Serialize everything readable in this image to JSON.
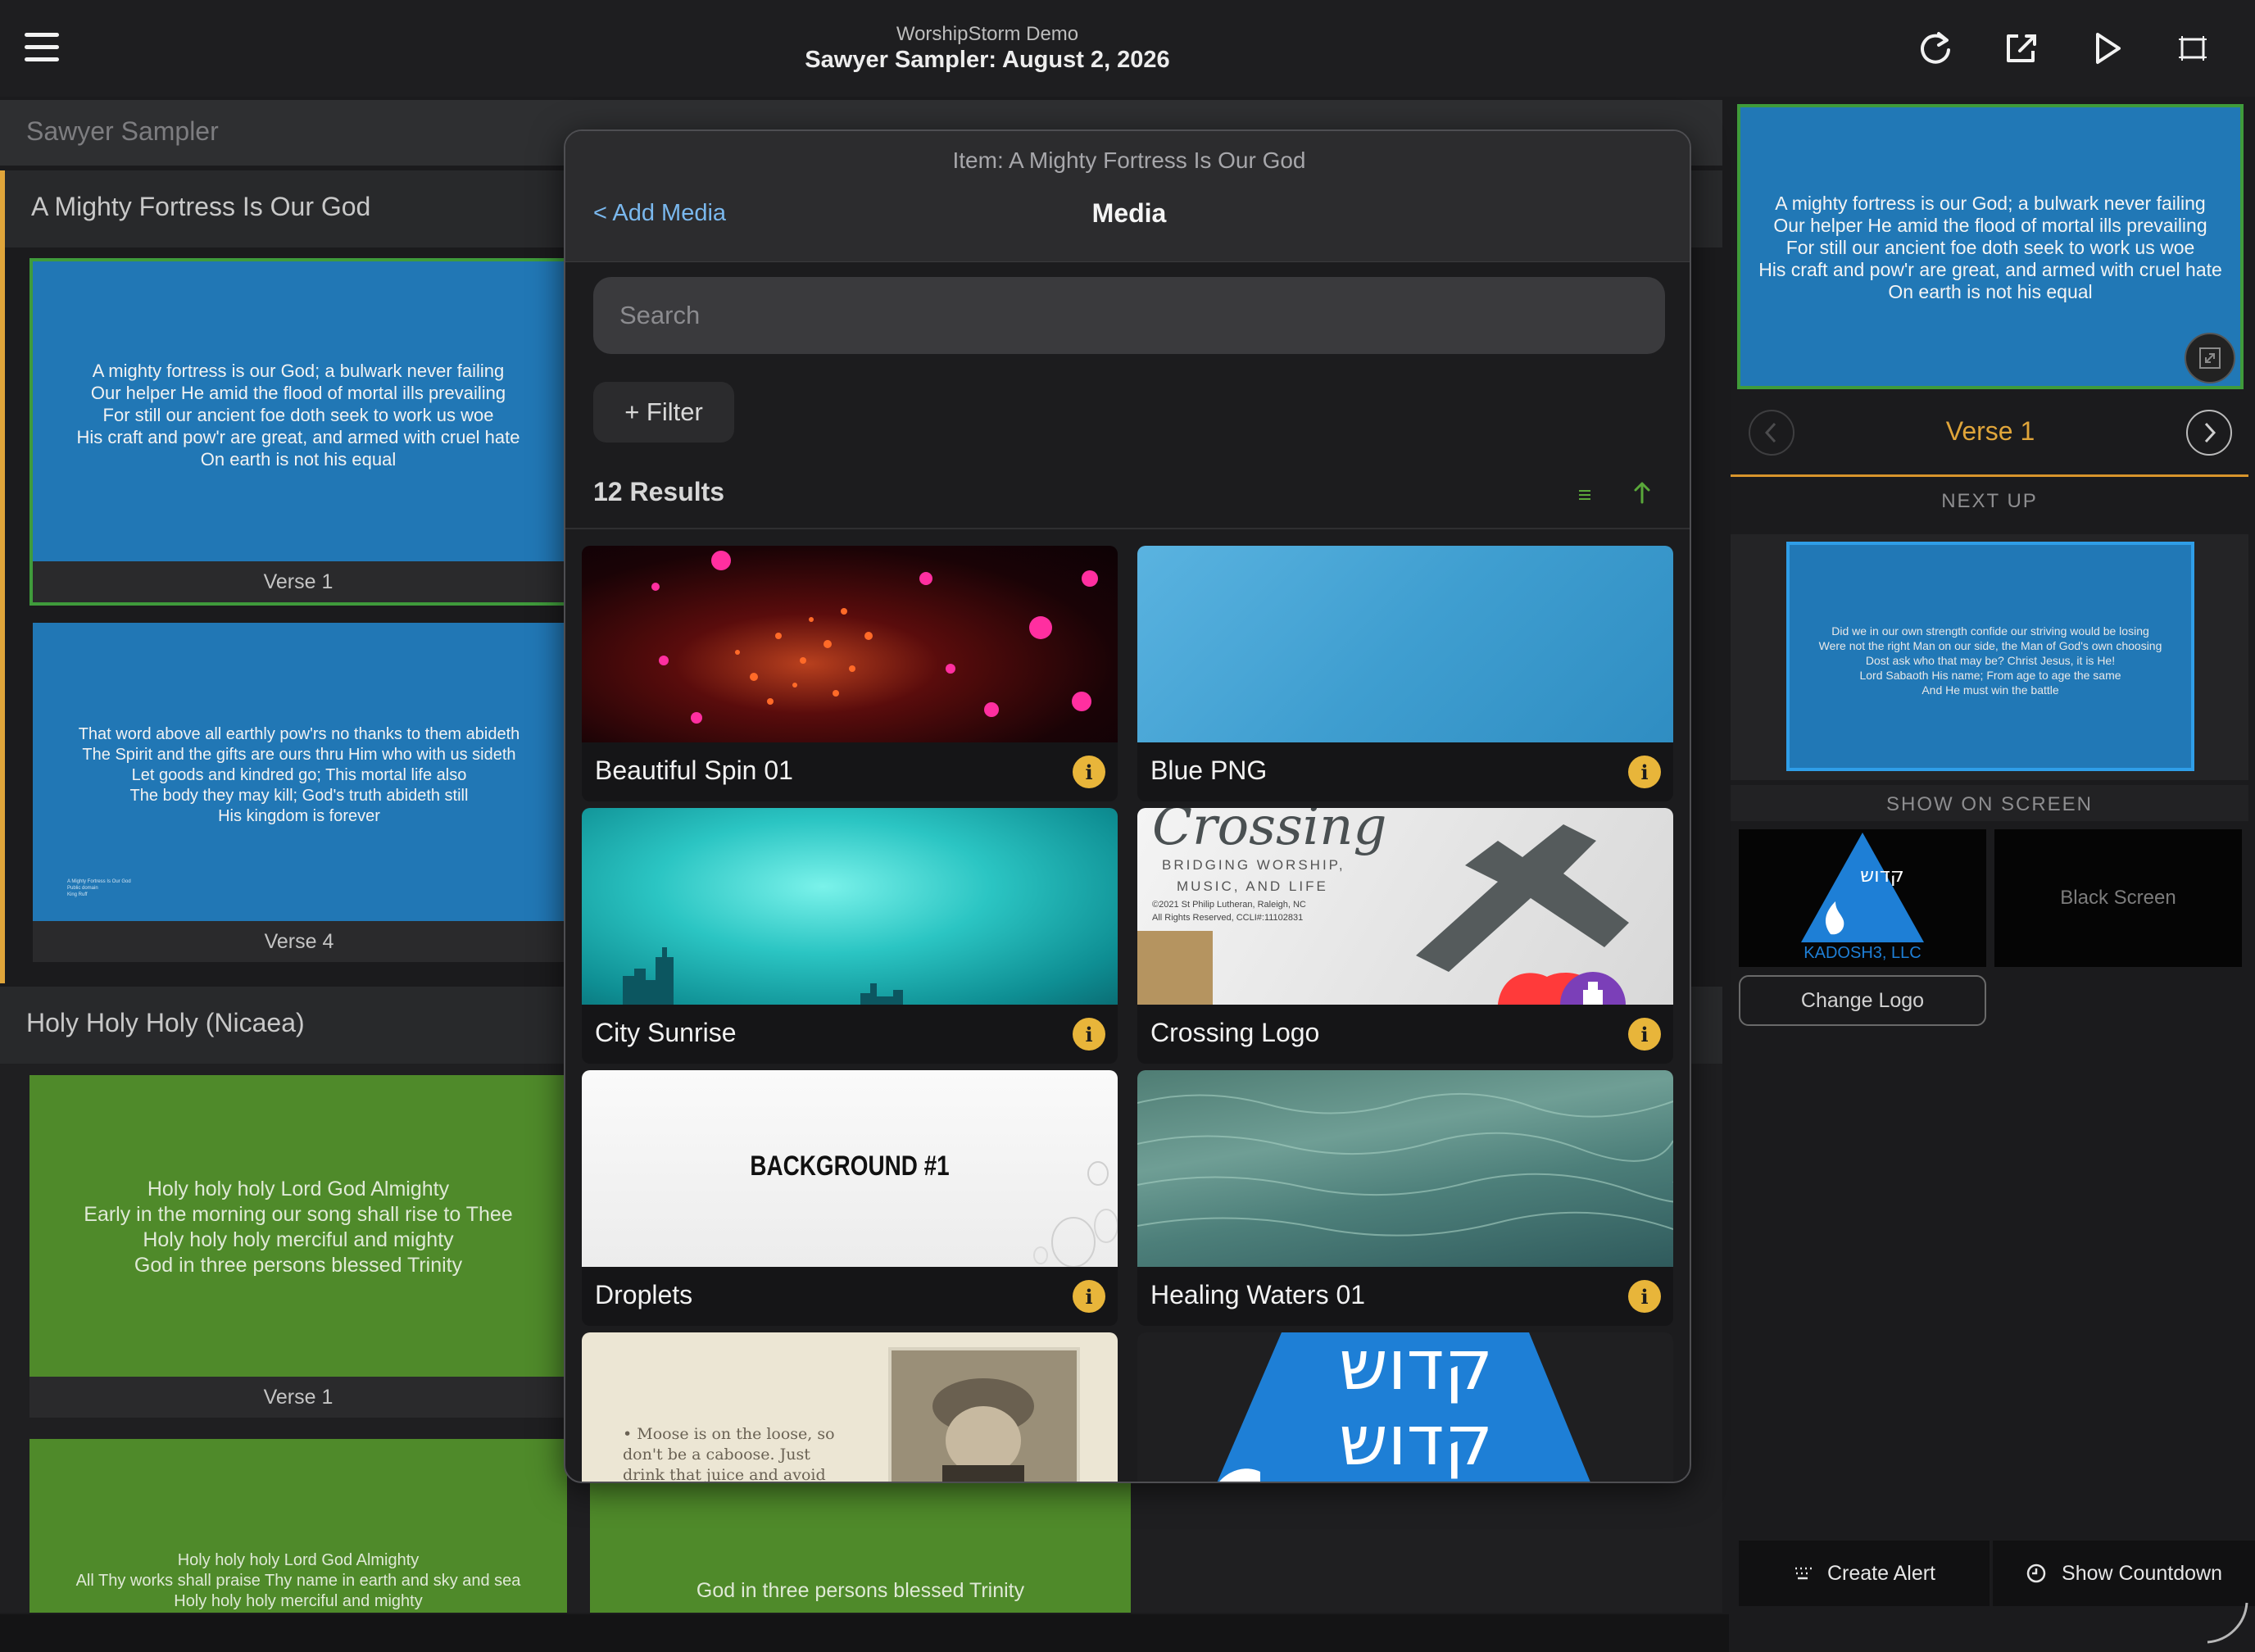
{
  "app": {
    "org": "WorshipStorm Demo",
    "title": "Sawyer Sampler: August 2, 2026"
  },
  "toolbar": {
    "menu_icon": "hamburger-menu-icon",
    "icons": [
      "refresh-icon",
      "edit-external-icon",
      "play-icon",
      "screen-layout-icon"
    ]
  },
  "service": {
    "name": "Sawyer Sampler",
    "items": [
      {
        "name": "A Mighty Fortress Is Our God",
        "slides": [
          {
            "label": "Verse 1",
            "text": "A mighty fortress is our God; a bulwark never failing\nOur helper He amid the flood of mortal ills prevailing\nFor still our ancient foe doth seek to work us woe\nHis craft and pow'r are great, and armed with cruel hate\nOn earth is not his equal"
          },
          {
            "label": "Verse 4",
            "text": "That word above all earthly pow'rs no thanks to them abideth\nThe Spirit and the gifts are ours thru Him who with us sideth\nLet goods and kindred go; This mortal life also\nThe body they may kill; God's truth abideth still\nHis kingdom is forever",
            "fine_print": "A Mighty Fortress Is Our God\nPublic domain\nKing Ruff"
          }
        ]
      },
      {
        "name": "Holy Holy Holy (Nicaea)",
        "slides": [
          {
            "label": "Verse 1",
            "text": "Holy holy holy Lord God Almighty\nEarly in the morning our song shall rise to Thee\nHoly holy holy merciful and mighty\nGod in three persons blessed Trinity"
          },
          {
            "label": "",
            "text": "Holy holy holy Lord God Almighty\nAll Thy works shall praise Thy name in earth and sky and sea\nHoly holy holy merciful and mighty"
          },
          {
            "label": "",
            "text": "God in three persons blessed Trinity"
          }
        ]
      }
    ]
  },
  "preview": {
    "live_text": "A mighty fortress is our God; a bulwark never failing\nOur helper He amid the flood of mortal ills prevailing\nFor still our ancient foe doth seek to work us woe\nHis craft and pow'r are great, and armed with cruel hate\nOn earth is not his equal",
    "current_label": "Verse 1",
    "next_up_heading": "NEXT UP",
    "next_up_text": "Did we in our own strength confide our striving would be losing\nWere not the right Man on our side, the Man of God's own choosing\nDost ask who that may be? Christ Jesus, it is He!\nLord Sabaoth His name; From age to age the same\nAnd He must win the battle",
    "show_on_screen_heading": "SHOW ON SCREEN",
    "logo_caption": "KADOSH3, LLC",
    "logo_glyphs": "קדוש",
    "black_screen": "Black Screen",
    "change_logo": "Change Logo",
    "create_alert": "Create Alert",
    "show_countdown": "Show Countdown"
  },
  "modal": {
    "subtitle": "Item: A Mighty Fortress Is Our God",
    "back_label": "< Add Media",
    "title": "Media",
    "search_placeholder": "Search",
    "filter_label": "+ Filter",
    "results_label": "12 Results",
    "media": [
      {
        "name": "Beautiful Spin 01"
      },
      {
        "name": "Blue PNG"
      },
      {
        "name": "City Sunrise"
      },
      {
        "name": "Crossing Logo",
        "thumb_title": "Crossing",
        "thumb_line1": "BRIDGING WORSHIP,",
        "thumb_line2": "MUSIC, AND LIFE",
        "thumb_line3": "©2021 St Philip Lutheran, Raleigh, NC",
        "thumb_line4": "All Rights Reserved, CCLI#:11102831"
      },
      {
        "name": "Droplets",
        "thumb_text": "BACKGROUND #1"
      },
      {
        "name": "Healing Waters 01"
      },
      {
        "name": "",
        "thumb_text": "• Moose is on the loose, so\ndon't be a caboose. Just\ndrink that juice and avoid"
      },
      {
        "name": "",
        "thumb_text": "קדוש\nקדוש"
      }
    ],
    "info_glyph": "i"
  },
  "colors": {
    "accent_orange": "#e0a53a",
    "live_border_green": "#3f9b3b",
    "slide_blue": "#2177b5",
    "slide_green": "#4f8a2a",
    "link_blue": "#7ab8ee"
  }
}
